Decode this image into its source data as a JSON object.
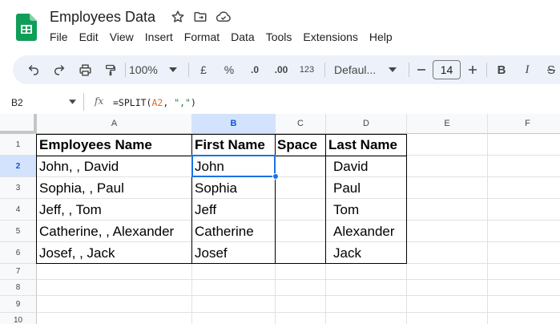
{
  "app": {
    "doc_title": "Employees Data",
    "menu": [
      "File",
      "Edit",
      "View",
      "Insert",
      "Format",
      "Data",
      "Tools",
      "Extensions",
      "Help"
    ]
  },
  "toolbar": {
    "zoom": "100%",
    "currency": "£",
    "percent": "%",
    "decrease_decimal": ".0",
    "increase_decimal": ".00",
    "number_format": "123",
    "font": "Defaul...",
    "font_size": "14",
    "bold": "B",
    "italic": "I",
    "strike": "S"
  },
  "formula_bar": {
    "cell_ref": "B2",
    "fx": "fx",
    "formula_prefix": "=SPLIT(",
    "formula_ref": "A2",
    "formula_mid": ", ",
    "formula_str": "\",\"",
    "formula_suffix": ")"
  },
  "columns": [
    "A",
    "B",
    "C",
    "D",
    "E",
    "F"
  ],
  "rows": [
    "1",
    "2",
    "3",
    "4",
    "5",
    "6",
    "7",
    "8",
    "9",
    "10"
  ],
  "selected": {
    "column": "B",
    "row": "2"
  },
  "table": {
    "headers": [
      "Employees Name",
      "First Name",
      "Space",
      "Last Name"
    ],
    "rows": [
      [
        "John, , David",
        "John",
        "",
        "David"
      ],
      [
        "Sophia, , Paul",
        "Sophia",
        "",
        "Paul"
      ],
      [
        "Jeff, , Tom",
        "Jeff",
        "",
        "Tom"
      ],
      [
        "Catherine, , Alexander",
        "Catherine",
        "",
        "Alexander"
      ],
      [
        "Josef, , Jack",
        "Josef",
        "",
        "Jack"
      ]
    ]
  },
  "colors": {
    "accent": "#1a73e8",
    "selected_header": "#d3e3fd",
    "toolbar_bg": "#edf2fa",
    "sheets_green": "#0f9d58"
  }
}
